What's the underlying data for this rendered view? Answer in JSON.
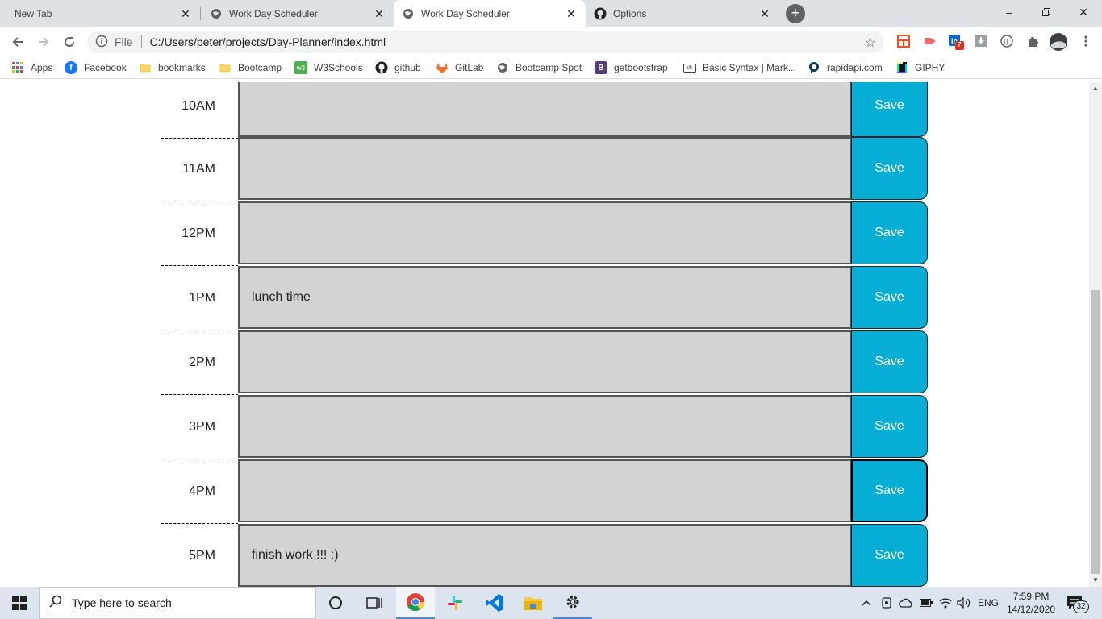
{
  "browser": {
    "tabs": [
      {
        "title": "New Tab",
        "favicon": "none"
      },
      {
        "title": "Work Day Scheduler",
        "favicon": "globe-icon"
      },
      {
        "title": "Work Day Scheduler",
        "favicon": "globe-icon"
      },
      {
        "title": "Options",
        "favicon": "github-icon"
      }
    ],
    "active_tab_index": 2,
    "address": {
      "scheme_label": "File",
      "url": "C:/Users/peter/projects/Day-Planner/index.html"
    },
    "linkedin_badge": "7",
    "bookmarks": [
      {
        "label": "Apps",
        "icon": "apps-grid-icon"
      },
      {
        "label": "Facebook",
        "icon": "facebook-icon"
      },
      {
        "label": "bookmarks",
        "icon": "folder-icon"
      },
      {
        "label": "Bootcamp",
        "icon": "folder-icon"
      },
      {
        "label": "W3Schools",
        "icon": "w3schools-icon"
      },
      {
        "label": "github",
        "icon": "github-icon"
      },
      {
        "label": "GitLab",
        "icon": "gitlab-icon"
      },
      {
        "label": "Bootcamp Spot",
        "icon": "globe-icon"
      },
      {
        "label": "getbootstrap",
        "icon": "bootstrap-icon"
      },
      {
        "label": "Basic Syntax | Mark...",
        "icon": "markdown-icon"
      },
      {
        "label": "rapidapi.com",
        "icon": "rapidapi-icon"
      },
      {
        "label": "GIPHY",
        "icon": "giphy-icon"
      }
    ]
  },
  "scheduler": {
    "save_label": "Save",
    "rows": [
      {
        "hour": "10AM",
        "text": ""
      },
      {
        "hour": "11AM",
        "text": ""
      },
      {
        "hour": "12PM",
        "text": ""
      },
      {
        "hour": "1PM",
        "text": "lunch time"
      },
      {
        "hour": "2PM",
        "text": ""
      },
      {
        "hour": "3PM",
        "text": ""
      },
      {
        "hour": "4PM",
        "text": ""
      },
      {
        "hour": "5PM",
        "text": "finish work !!! :)"
      }
    ],
    "colors": {
      "past": "#d3d3d3",
      "save": "#06aed5"
    }
  },
  "taskbar": {
    "search_placeholder": "Type here to search",
    "language": "ENG",
    "time": "7:59 PM",
    "date": "14/12/2020",
    "notification_count": "32"
  }
}
